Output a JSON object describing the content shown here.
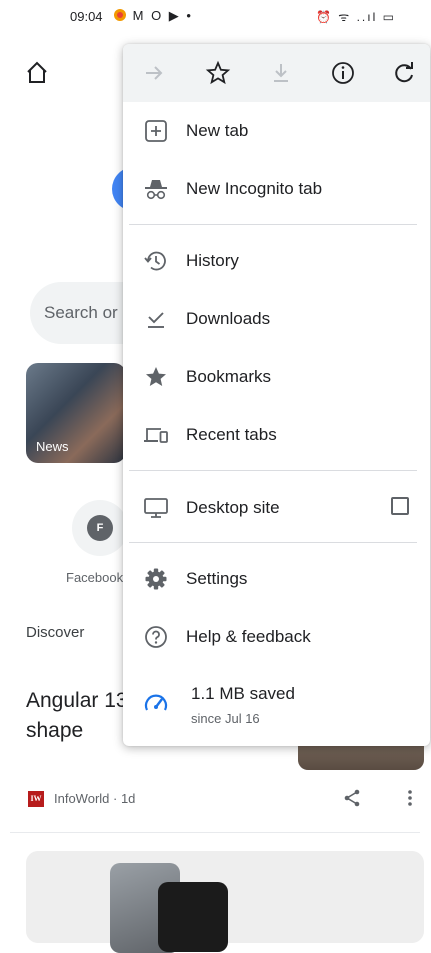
{
  "status_bar": {
    "time": "09:04",
    "left_icons": "M O ▶ •",
    "right_icons": "⏰ ᯤ ..ıl ▭"
  },
  "background_page": {
    "search_placeholder": "Search or",
    "news_tile_label": "News",
    "shortcut_initial": "F",
    "shortcut_label": "Facebook",
    "discover_label": "Discover",
    "headline_line1": "Angular 13",
    "headline_line2": "shape",
    "source_icon_text": "IW",
    "source_meta": "InfoWorld · 1d"
  },
  "menu": {
    "toolbar_icons": [
      "forward-icon",
      "bookmark-star-icon",
      "download-icon",
      "info-icon",
      "refresh-icon"
    ],
    "items": [
      {
        "label": "New tab",
        "icon": "new-tab-icon"
      },
      {
        "label": "New Incognito tab",
        "icon": "incognito-icon"
      },
      {
        "label": "History",
        "icon": "history-icon"
      },
      {
        "label": "Downloads",
        "icon": "downloads-icon"
      },
      {
        "label": "Bookmarks",
        "icon": "bookmarks-icon"
      },
      {
        "label": "Recent tabs",
        "icon": "recent-tabs-icon"
      },
      {
        "label": "Desktop site",
        "icon": "desktop-icon",
        "checked": false
      },
      {
        "label": "Settings",
        "icon": "settings-icon"
      },
      {
        "label": "Help & feedback",
        "icon": "help-icon"
      }
    ],
    "data_saver": {
      "amount": "1.1 MB saved",
      "since": "since Jul 16",
      "accent": "#1a73e8"
    }
  },
  "colors": {
    "toolbar_bg": "#f1f3f4",
    "icon_gray": "#5f6368",
    "disabled_gray": "#bdc1c6"
  }
}
